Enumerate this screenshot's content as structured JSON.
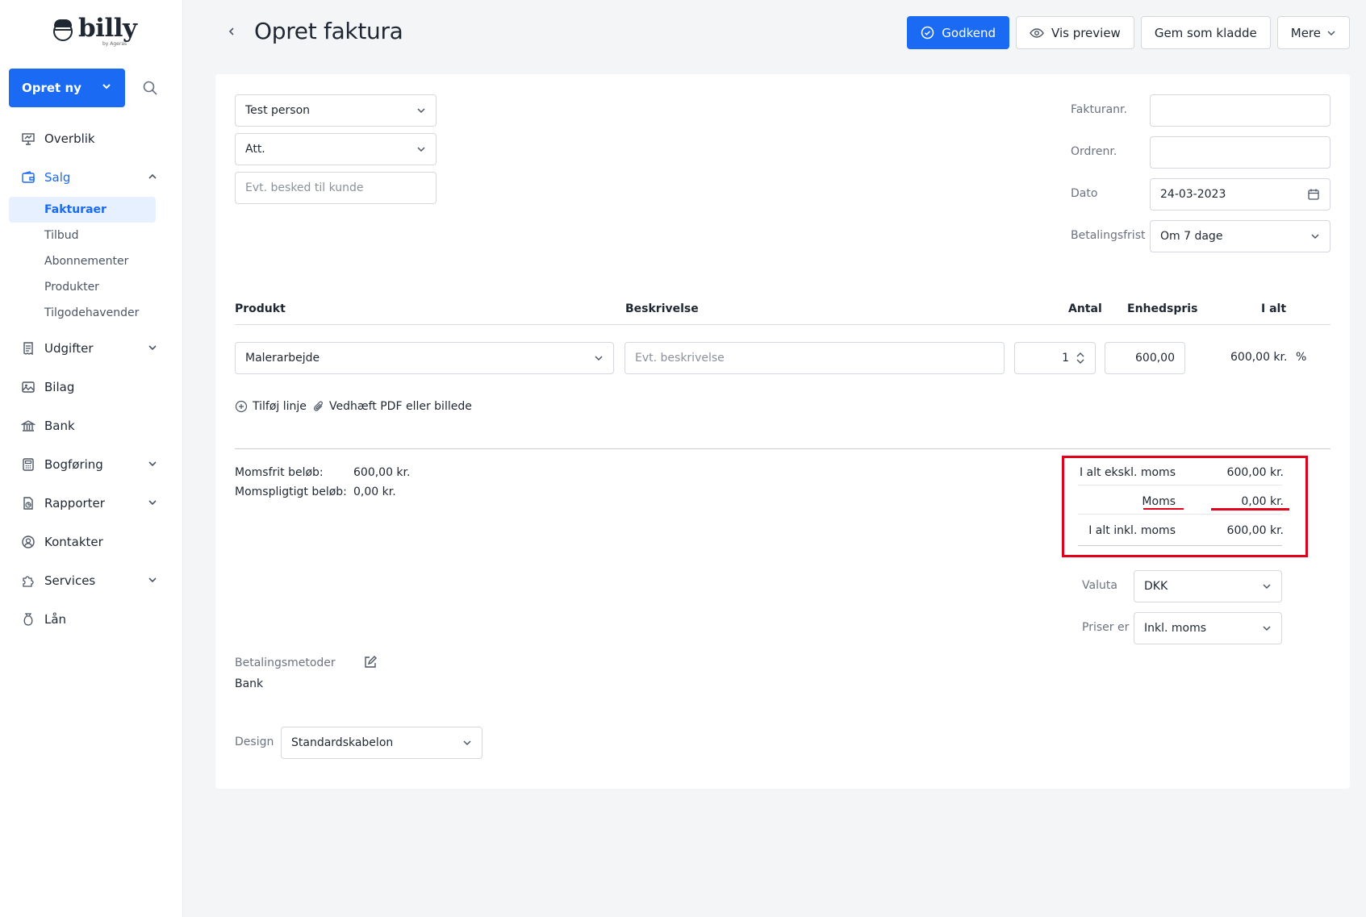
{
  "app": {
    "brand": "billy",
    "brand_sub": "by Ageras"
  },
  "sidebar": {
    "create_label": "Opret ny",
    "items": [
      {
        "label": "Overblik",
        "icon": "presentation-icon"
      },
      {
        "label": "Salg",
        "icon": "wallet-icon",
        "expanded": true
      },
      {
        "label": "Udgifter",
        "icon": "receipt-icon"
      },
      {
        "label": "Bilag",
        "icon": "image-icon"
      },
      {
        "label": "Bank",
        "icon": "bank-icon"
      },
      {
        "label": "Bogføring",
        "icon": "calculator-icon"
      },
      {
        "label": "Rapporter",
        "icon": "report-icon"
      },
      {
        "label": "Kontakter",
        "icon": "contact-icon"
      },
      {
        "label": "Services",
        "icon": "puzzle-icon"
      },
      {
        "label": "Lån",
        "icon": "money-bag-icon"
      }
    ],
    "sales_sub": [
      "Fakturaer",
      "Tilbud",
      "Abonnementer",
      "Produkter",
      "Tilgodehavender"
    ]
  },
  "header": {
    "title": "Opret faktura",
    "approve_label": "Godkend",
    "preview_label": "Vis preview",
    "draft_label": "Gem som kladde",
    "more_label": "Mere"
  },
  "customer": {
    "contact_value": "Test person",
    "att_value": "Att.",
    "message_placeholder": "Evt. besked til kunde"
  },
  "meta": {
    "invoice_no_label": "Fakturanr.",
    "invoice_no_value": "",
    "order_no_label": "Ordrenr.",
    "order_no_value": "",
    "date_label": "Dato",
    "date_value": "24-03-2023",
    "due_label": "Betalingsfrist",
    "due_value": "Om 7 dage"
  },
  "lines": {
    "headers": {
      "product": "Produkt",
      "description": "Beskrivelse",
      "qty": "Antal",
      "unit_price": "Enhedspris",
      "total": "I alt"
    },
    "rows": [
      {
        "product": "Malerarbejde",
        "description_placeholder": "Evt. beskrivelse",
        "qty": "1",
        "unit_price": "600,00",
        "total": "600,00 kr.",
        "discount": "%"
      }
    ],
    "add_line_label": "Tilføj linje",
    "attach_label": "Vedhæft PDF eller billede"
  },
  "vat_breakdown": {
    "exempt_label": "Momsfrit beløb:",
    "exempt_value": "600,00 kr.",
    "liable_label": "Momspligtigt beløb:",
    "liable_value": "0,00 kr."
  },
  "totals": {
    "excl_label": "I alt ekskl. moms",
    "excl_value": "600,00 kr.",
    "vat_label": "Moms",
    "vat_value": "0,00 kr.",
    "incl_label": "I alt inkl. moms",
    "incl_value": "600,00 kr."
  },
  "settings": {
    "currency_label": "Valuta",
    "currency_value": "DKK",
    "prices_label": "Priser er",
    "prices_value": "Inkl. moms"
  },
  "payment": {
    "methods_label": "Betalingsmetoder",
    "methods_value": "Bank"
  },
  "design": {
    "label": "Design",
    "value": "Standardskabelon"
  },
  "colors": {
    "accent": "#1a6af4",
    "highlight": "#e2001a",
    "sidebar_active_bg": "#e7f0fe"
  }
}
